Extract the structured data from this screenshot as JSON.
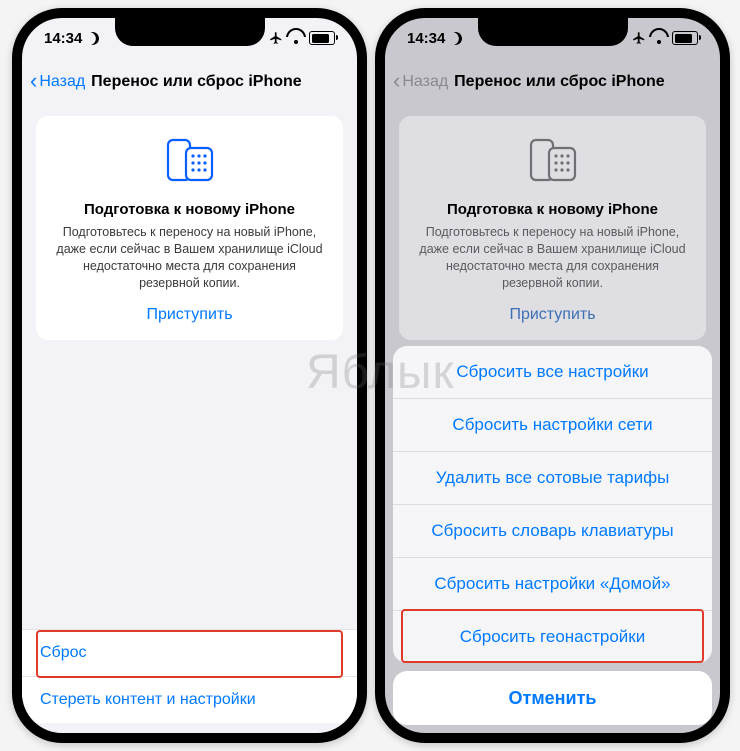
{
  "watermark": "Яблык",
  "status": {
    "time": "14:34"
  },
  "nav": {
    "back": "Назад",
    "title": "Перенос или сброс iPhone"
  },
  "card": {
    "title": "Подготовка к новому iPhone",
    "desc": "Подготовьтесь к переносу на новый iPhone, даже если сейчас в Вашем хранилище iCloud недостаточно места для сохранения резервной копии.",
    "action": "Приступить"
  },
  "bottom": {
    "reset": "Сброс",
    "erase": "Стереть контент и настройки"
  },
  "sheet": {
    "items": [
      "Сбросить все настройки",
      "Сбросить настройки сети",
      "Удалить все сотовые тарифы",
      "Сбросить словарь клавиатуры",
      "Сбросить настройки «Домой»",
      "Сбросить геонастройки"
    ],
    "cancel": "Отменить"
  }
}
